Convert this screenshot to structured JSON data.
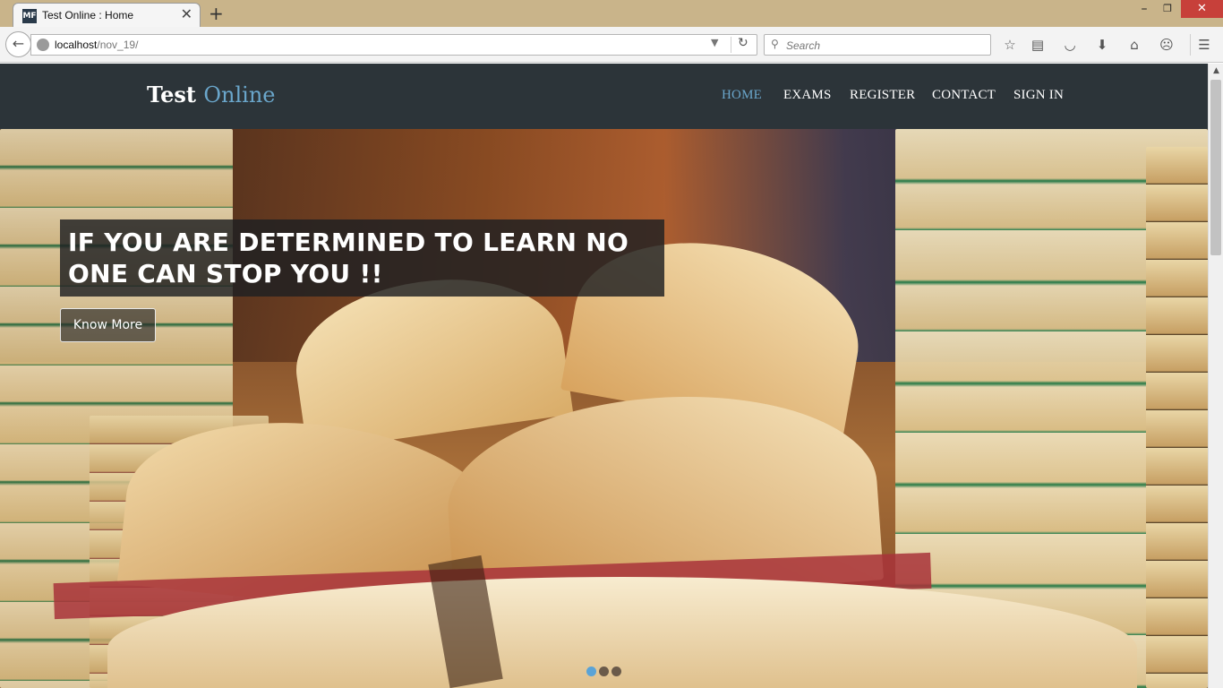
{
  "browser": {
    "tab_title": "Test Online : Home",
    "tab_favicon": "MF",
    "tab_close": "✕",
    "new_tab": "+",
    "url_host": "localhost",
    "url_path": "/nov_19/",
    "search_placeholder": "Search",
    "window_controls": {
      "minimize": "–",
      "maximize": "❐",
      "close": "✕"
    },
    "toolbar_icons": [
      "bookmark-star-icon",
      "reading-list-icon",
      "pocket-icon",
      "download-icon",
      "home-icon",
      "feedback-icon",
      "menu-icon"
    ],
    "icons": {
      "back": "←",
      "reload": "↻",
      "dropdown": "▼",
      "search": "⚲",
      "star": "☆",
      "reading": "▤",
      "pocket": "◡",
      "download": "⬇",
      "home": "⌂",
      "smiley": "☹",
      "menu": "☰"
    }
  },
  "site": {
    "brand_main": "Test",
    "brand_accent": "Online",
    "nav": [
      {
        "label": "HOME",
        "active": true
      },
      {
        "label": "EXAMS",
        "active": false
      },
      {
        "label": "REGISTER",
        "active": false
      },
      {
        "label": "CONTACT",
        "active": false
      },
      {
        "label": "SIGN IN",
        "active": false
      }
    ],
    "colors": {
      "header_bg": "#2c3439",
      "accent": "#6aa6cb",
      "active_dot": "#5aa3d6"
    }
  },
  "hero": {
    "caption": "IF YOU ARE DETERMINED TO LEARN NO ONE CAN STOP YOU !!",
    "button_label": "Know More",
    "slides": 3,
    "active_slide": 1
  }
}
